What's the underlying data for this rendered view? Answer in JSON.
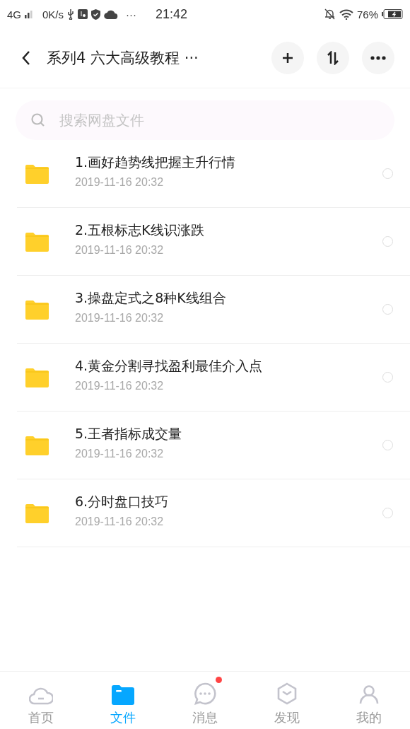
{
  "status_bar": {
    "network": "4G",
    "speed": "0K/s",
    "more": "···",
    "time": "21:42",
    "battery": "76%"
  },
  "header": {
    "title": "系列4 六大高级教程 ···"
  },
  "search": {
    "placeholder": "搜索网盘文件"
  },
  "files": [
    {
      "name": "1.画好趋势线把握主升行情",
      "date": "2019-11-16  20:32",
      "selected": false
    },
    {
      "name": "2.五根标志K线识涨跌",
      "date": "2019-11-16  20:32",
      "selected": false
    },
    {
      "name": "3.操盘定式之8种K线组合",
      "date": "2019-11-16  20:32",
      "selected": false
    },
    {
      "name": "4.黄金分割寻找盈利最佳介入点",
      "date": "2019-11-16  20:32",
      "selected": false
    },
    {
      "name": "5.王者指标成交量",
      "date": "2019-11-16  20:32",
      "selected": false
    },
    {
      "name": "6.分时盘口技巧",
      "date": "2019-11-16  20:32",
      "selected": false
    }
  ],
  "tabs": [
    {
      "kind": "home",
      "label": "首页",
      "selected": false,
      "badge": false
    },
    {
      "kind": "files",
      "label": "文件",
      "selected": true,
      "badge": false
    },
    {
      "kind": "messages",
      "label": "消息",
      "selected": false,
      "badge": true
    },
    {
      "kind": "discover",
      "label": "发现",
      "selected": false,
      "badge": false
    },
    {
      "kind": "me",
      "label": "我的",
      "selected": false,
      "badge": false
    }
  ]
}
